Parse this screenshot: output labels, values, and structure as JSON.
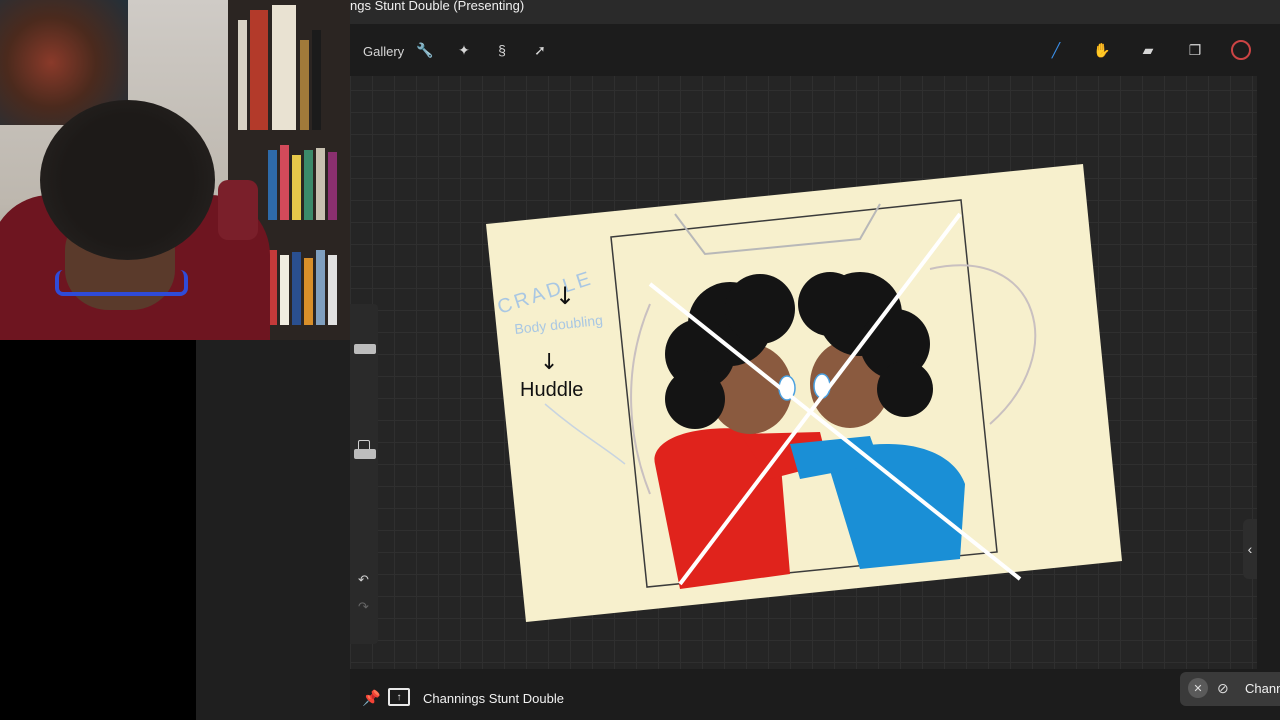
{
  "presentation": {
    "title": "ngs Stunt Double (Presenting)"
  },
  "procreate": {
    "gallery_label": "Gallery",
    "toolbar_icons": [
      "wrench-icon",
      "magic-wand-icon",
      "selection-icon",
      "transform-arrow-icon",
      "brush-icon",
      "smudge-icon",
      "eraser-icon",
      "layers-icon",
      "color-icon"
    ]
  },
  "drawing": {
    "note_line_1": "CRADLE",
    "note_line_2": "Body doubling",
    "note_line_3": "Huddle"
  },
  "meeting_bar": {
    "presenter_name": "Channings Stunt Double",
    "participant_name": "Chann"
  },
  "colors": {
    "paper": "#f7f0cd",
    "red_shirt": "#e0231c",
    "blue_shirt": "#1a8fd6",
    "accent_brush": "#3a8ee8"
  }
}
